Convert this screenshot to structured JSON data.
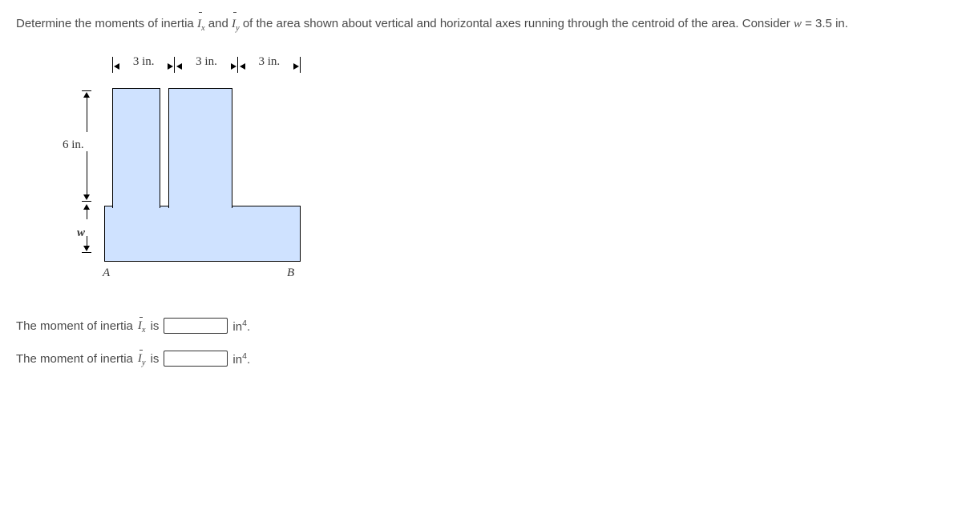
{
  "problem": {
    "text_part1": "Determine the moments of inertia ",
    "ix_label": "I",
    "ix_sub": "x",
    "text_part2": " and ",
    "iy_label": "I",
    "iy_sub": "y",
    "text_part3": " of the area shown about vertical and horizontal axes running through the centroid of the area. Consider ",
    "w_expr_var": "w",
    "w_expr_rest": " = 3.5 in."
  },
  "figure": {
    "top_dims": [
      "3 in.",
      "3 in.",
      "3 in."
    ],
    "left_dim_6": "6 in.",
    "left_dim_w": "w",
    "point_a": "A",
    "point_b": "B"
  },
  "answers": {
    "row1": {
      "prefix": "The moment of inertia ",
      "sym": "I",
      "sub": "x",
      "conn": " is",
      "unit_prefix": "in",
      "unit_exp": "4",
      "unit_suffix": "."
    },
    "row2": {
      "prefix": "The moment of inertia ",
      "sym": "I",
      "sub": "y",
      "conn": " is",
      "unit_prefix": "in",
      "unit_exp": "4",
      "unit_suffix": "."
    }
  }
}
